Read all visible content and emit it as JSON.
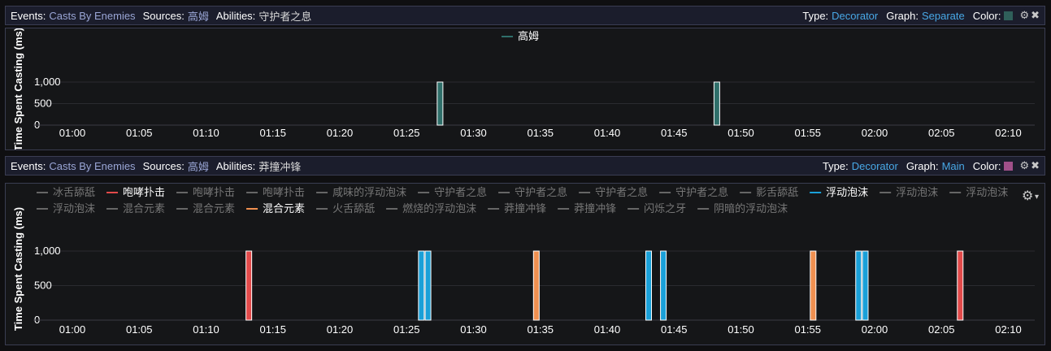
{
  "panels": [
    {
      "header": {
        "events_label": "Events:",
        "events_value": "Casts By Enemies",
        "sources_label": "Sources:",
        "sources_value": "高姆",
        "abilities_label": "Abilities:",
        "abilities_value": "守护者之息",
        "type_label": "Type:",
        "type_value": "Decorator",
        "graph_label": "Graph:",
        "graph_value": "Separate",
        "color_label": "Color:",
        "color_swatch": "#2f5f5a",
        "settings_icon": "gear-icon",
        "close_icon": "close-icon"
      },
      "legend": [
        {
          "label": "高姆",
          "color": "#2f6f6a",
          "active": true
        }
      ],
      "ylabel": "Time Spent Casting (ms)"
    },
    {
      "header": {
        "events_label": "Events:",
        "events_value": "Casts By Enemies",
        "sources_label": "Sources:",
        "sources_value": "高姆",
        "abilities_label": "Abilities:",
        "abilities_value": "莽撞冲锋",
        "type_label": "Type:",
        "type_value": "Decorator",
        "graph_label": "Graph:",
        "graph_value": "Main",
        "color_label": "Color:",
        "color_swatch": "#a0508a",
        "settings_icon": "gear-icon",
        "close_icon": "close-icon"
      },
      "legend_rows": [
        [
          {
            "label": "冰舌舔舐",
            "color": "#666666",
            "active": false
          },
          {
            "label": "咆哮扑击",
            "color": "#e24a4a",
            "active": true
          },
          {
            "label": "咆哮扑击",
            "color": "#666666",
            "active": false
          },
          {
            "label": "咆哮扑击",
            "color": "#666666",
            "active": false
          },
          {
            "label": "咸味的浮动泡沫",
            "color": "#666666",
            "active": false
          },
          {
            "label": "守护者之息",
            "color": "#666666",
            "active": false
          },
          {
            "label": "守护者之息",
            "color": "#666666",
            "active": false
          },
          {
            "label": "守护者之息",
            "color": "#666666",
            "active": false
          },
          {
            "label": "守护者之息",
            "color": "#666666",
            "active": false
          },
          {
            "label": "影舌舔舐",
            "color": "#666666",
            "active": false
          },
          {
            "label": "浮动泡沫",
            "color": "#1aa0d8",
            "active": true
          },
          {
            "label": "浮动泡沫",
            "color": "#666666",
            "active": false
          },
          {
            "label": "浮动泡沫",
            "color": "#666666",
            "active": false
          }
        ],
        [
          {
            "label": "浮动泡沫",
            "color": "#666666",
            "active": false
          },
          {
            "label": "混合元素",
            "color": "#666666",
            "active": false
          },
          {
            "label": "混合元素",
            "color": "#666666",
            "active": false
          },
          {
            "label": "混合元素",
            "color": "#f09050",
            "active": true
          },
          {
            "label": "火舌舔舐",
            "color": "#666666",
            "active": false
          },
          {
            "label": "燃烧的浮动泡沫",
            "color": "#666666",
            "active": false
          },
          {
            "label": "莽撞冲锋",
            "color": "#666666",
            "active": false
          },
          {
            "label": "莽撞冲锋",
            "color": "#666666",
            "active": false
          },
          {
            "label": "闪烁之牙",
            "color": "#666666",
            "active": false
          },
          {
            "label": "阴暗的浮动泡沫",
            "color": "#666666",
            "active": false
          }
        ]
      ],
      "ylabel": "Time Spent Casting (ms)",
      "settings_icon": "gear-icon"
    }
  ],
  "chart_data": [
    {
      "type": "bar",
      "x_tick_labels": [
        "01:00",
        "01:05",
        "01:10",
        "01:15",
        "01:20",
        "01:25",
        "01:30",
        "01:35",
        "01:40",
        "01:45",
        "01:50",
        "01:55",
        "02:00",
        "02:05",
        "02:10"
      ],
      "xlim_seconds": [
        60,
        132
      ],
      "ylim": [
        0,
        1500
      ],
      "y_ticks": [
        0,
        500,
        1000
      ],
      "y_tick_labels": [
        "0",
        "500",
        "1,000"
      ],
      "ylabel": "Time Spent Casting (ms)",
      "series": [
        {
          "name": "高姆",
          "color": "#2f6f6a",
          "bars": [
            {
              "t": "01:27.5",
              "value": 1000
            },
            {
              "t": "01:48.2",
              "value": 1000
            }
          ]
        }
      ]
    },
    {
      "type": "bar",
      "x_tick_labels": [
        "01:00",
        "01:05",
        "01:10",
        "01:15",
        "01:20",
        "01:25",
        "01:30",
        "01:35",
        "01:40",
        "01:45",
        "01:50",
        "01:55",
        "02:00",
        "02:05",
        "02:10"
      ],
      "xlim_seconds": [
        60,
        132
      ],
      "ylim": [
        0,
        1500
      ],
      "y_ticks": [
        0,
        500,
        1000
      ],
      "y_tick_labels": [
        "0",
        "500",
        "1,000"
      ],
      "ylabel": "Time Spent Casting (ms)",
      "series": [
        {
          "name": "咆哮扑击",
          "color": "#e24a4a",
          "bars": [
            {
              "t": "01:13.2",
              "value": 1000
            },
            {
              "t": "02:06.4",
              "value": 1000
            }
          ]
        },
        {
          "name": "浮动泡沫",
          "color": "#1aa0d8",
          "bars": [
            {
              "t": "01:26.1",
              "value": 1000
            },
            {
              "t": "01:26.6",
              "value": 1000
            },
            {
              "t": "01:43.1",
              "value": 1000
            },
            {
              "t": "01:44.2",
              "value": 1000
            },
            {
              "t": "01:58.8",
              "value": 1000
            },
            {
              "t": "01:59.3",
              "value": 1000
            }
          ]
        },
        {
          "name": "混合元素",
          "color": "#f09050",
          "bars": [
            {
              "t": "01:34.7",
              "value": 1000
            },
            {
              "t": "01:55.4",
              "value": 1000
            }
          ]
        }
      ]
    }
  ]
}
